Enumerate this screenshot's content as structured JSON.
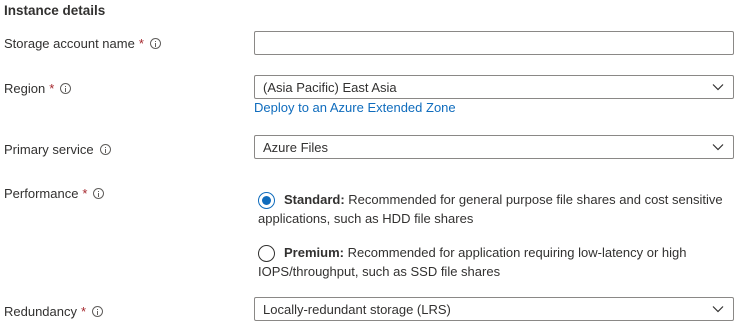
{
  "section": {
    "title": "Instance details"
  },
  "fields": {
    "storage_account_name": {
      "label": "Storage account name",
      "required_mark": "*",
      "value": ""
    },
    "region": {
      "label": "Region",
      "required_mark": "*",
      "value": "(Asia Pacific) East Asia",
      "link": "Deploy to an Azure Extended Zone"
    },
    "primary_service": {
      "label": "Primary service",
      "value": "Azure Files"
    },
    "performance": {
      "label": "Performance",
      "required_mark": "*",
      "options": [
        {
          "title": "Standard:",
          "description": "Recommended for general purpose file shares and cost sensitive",
          "description_line2": "applications, such as HDD file shares",
          "selected": true
        },
        {
          "title": "Premium:",
          "description": "Recommended for application requiring low-latency or high",
          "description_line2": "IOPS/throughput, such as SSD file shares",
          "selected": false
        }
      ]
    },
    "redundancy": {
      "label": "Redundancy",
      "required_mark": "*",
      "value": "Locally-redundant storage (LRS)"
    }
  },
  "colors": {
    "accent": "#0f6cbd",
    "required": "#a4262c",
    "text": "#323130",
    "border": "#8a8886"
  },
  "icons": {
    "info": "info-icon",
    "chevron": "chevron-down-icon"
  }
}
